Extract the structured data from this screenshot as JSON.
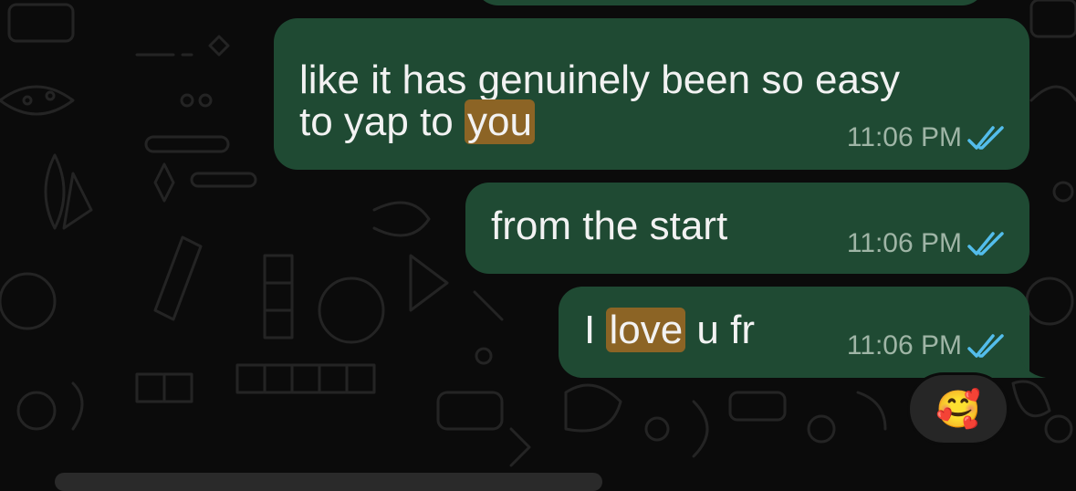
{
  "messages": [
    {
      "id": "msg1",
      "parts": {
        "line1": "like it has genuinely been so easy",
        "line2_pre": "to yap to ",
        "highlight": "you"
      },
      "time": "11:06 PM",
      "status": "read"
    },
    {
      "id": "msg2",
      "text": "from the start",
      "time": "11:06 PM",
      "status": "read"
    },
    {
      "id": "msg3",
      "parts": {
        "pre": "I ",
        "highlight": "love",
        "post": " u fr"
      },
      "time": "11:06 PM",
      "status": "read",
      "reaction": "🥰"
    }
  ],
  "colors": {
    "bubble_out": "#1f4a33",
    "highlight": "#8c6425",
    "tick_read": "#53bdeb",
    "background": "#0b0b0b"
  },
  "icons": {
    "read_receipt": "double-check-icon"
  }
}
